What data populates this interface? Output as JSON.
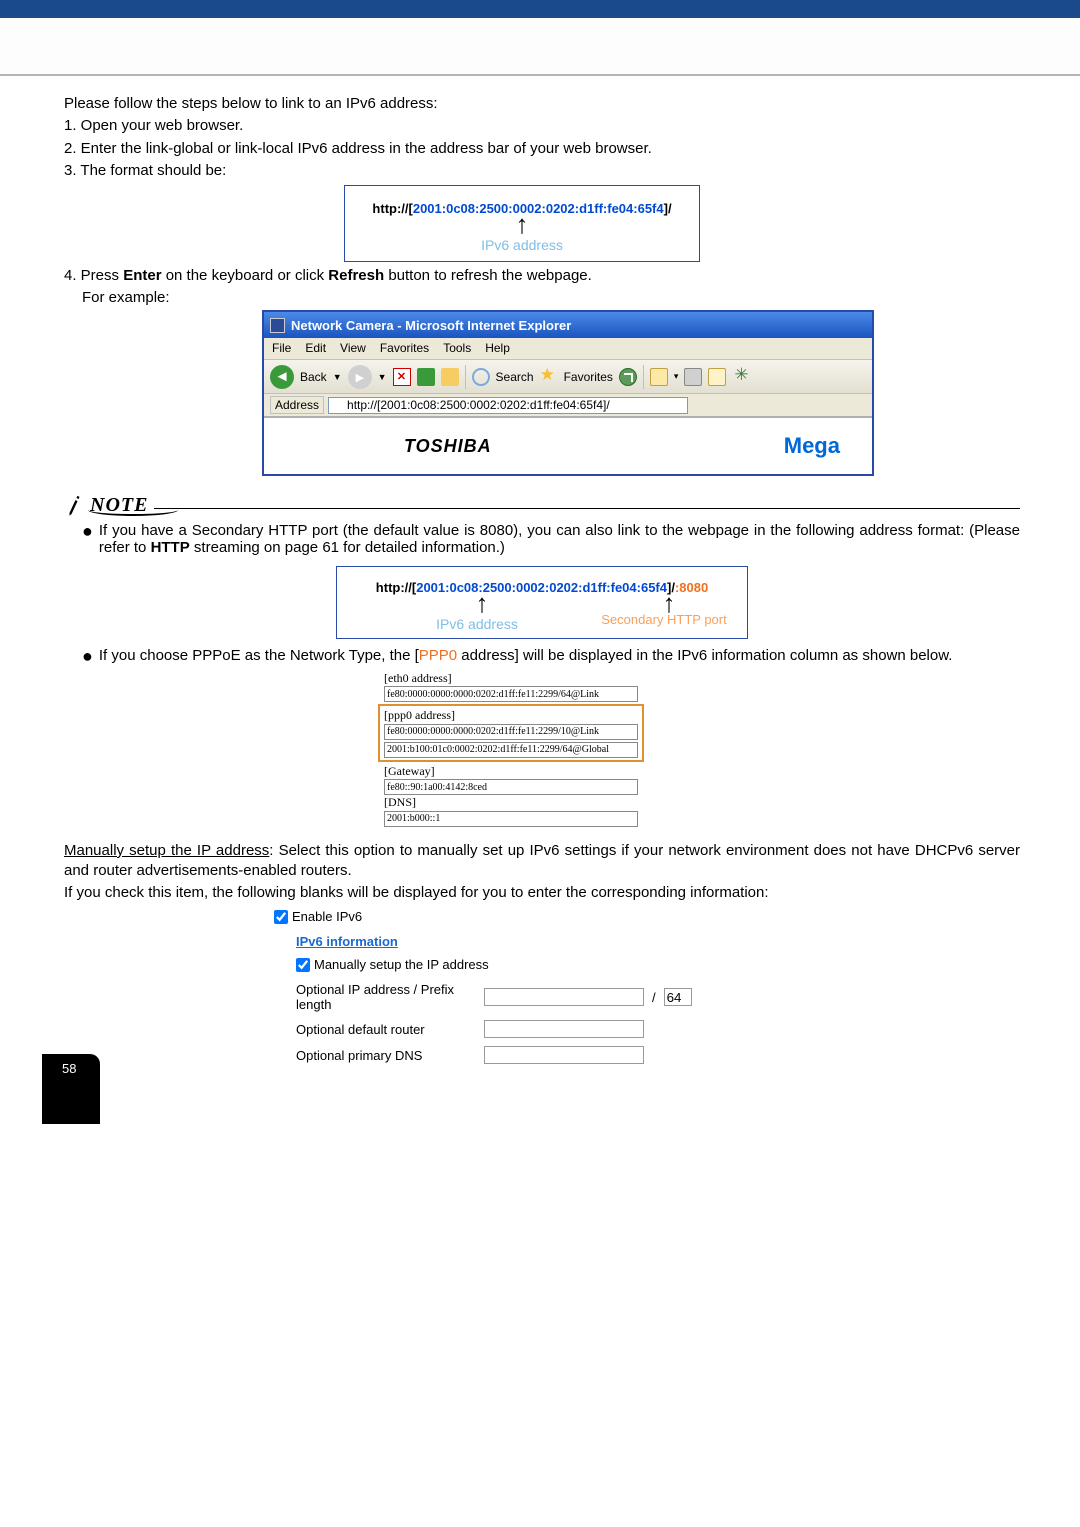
{
  "intro": {
    "p1": "Please follow the steps below to link to an IPv6 address:",
    "s1": "1. Open your web browser.",
    "s2": "2. Enter the link-global or link-local IPv6 address in the address bar of your web browser.",
    "s3": "3. The format should be:"
  },
  "fmt1": {
    "prefix": "http://[",
    "addr": "2001:0c08:2500:0002:0202:d1ff:fe04:65f4",
    "suffix": "]/",
    "label": "IPv6 address"
  },
  "step4": {
    "line_a": "4. Press ",
    "enter": "Enter",
    "line_b": " on the keyboard or click ",
    "refresh": "Refresh",
    "line_c": " button to refresh the webpage.",
    "example": "For example:"
  },
  "ie": {
    "title": "Network Camera - Microsoft Internet Explorer",
    "menu": [
      "File",
      "Edit",
      "View",
      "Favorites",
      "Tools",
      "Help"
    ],
    "back": "Back",
    "search": "Search",
    "favorites": "Favorites",
    "addr_label": "Address",
    "addr_value": "http://[2001:0c08:2500:0002:0202:d1ff:fe04:65f4]/",
    "brand1": "TOSHIBA",
    "brand2": "Mega"
  },
  "note": {
    "label": "NOTE"
  },
  "notebullet1": {
    "a": "If you have a Secondary HTTP port (the default value is 8080), you can also link to the webpage in the following address format: (Please refer to ",
    "b": "HTTP",
    "c": " streaming on page 61 for detailed information.)"
  },
  "fmt2": {
    "prefix": "http://[",
    "addr": "2001:0c08:2500:0002:0202:d1ff:fe04:65f4",
    "mid": "]/",
    "port": ":8080",
    "label1": "IPv6 address",
    "label2": "Secondary HTTP port"
  },
  "notebullet2": {
    "a": "If you choose PPPoE as the Network Type, the [",
    "b": "PPP0",
    "c": " address] will be displayed in the IPv6 information column as shown below."
  },
  "ipv6info": {
    "eth0_label": "[eth0 address]",
    "eth0_val": "fe80:0000:0000:0000:0202:d1ff:fe11:2299/64@Link",
    "ppp0_label": "[ppp0 address]",
    "ppp0_v1": "fe80:0000:0000:0000:0202:d1ff:fe11:2299/10@Link",
    "ppp0_v2": "2001:b100:01c0:0002:0202:d1ff:fe11:2299/64@Global",
    "gw_label": "[Gateway]",
    "gw_val": "fe80::90:1a00:4142:8ced",
    "dns_label": "[DNS]",
    "dns_val": "2001:b000::1"
  },
  "manual": {
    "head": "Manually setup the IP address",
    "tail": ": Select this option to manually set up IPv6 settings if your network environment does not have DHCPv6 server and router advertisements-enabled routers.",
    "p2": "If you check this item, the following blanks will be displayed for you to enter the corresponding information:"
  },
  "form": {
    "enable": "Enable IPv6",
    "section": "IPv6 information",
    "manual": "Manually setup the IP address",
    "r1": "Optional IP address / Prefix length",
    "prefix": "64",
    "r2": "Optional default router",
    "r3": "Optional primary DNS"
  },
  "pagenum": "58"
}
